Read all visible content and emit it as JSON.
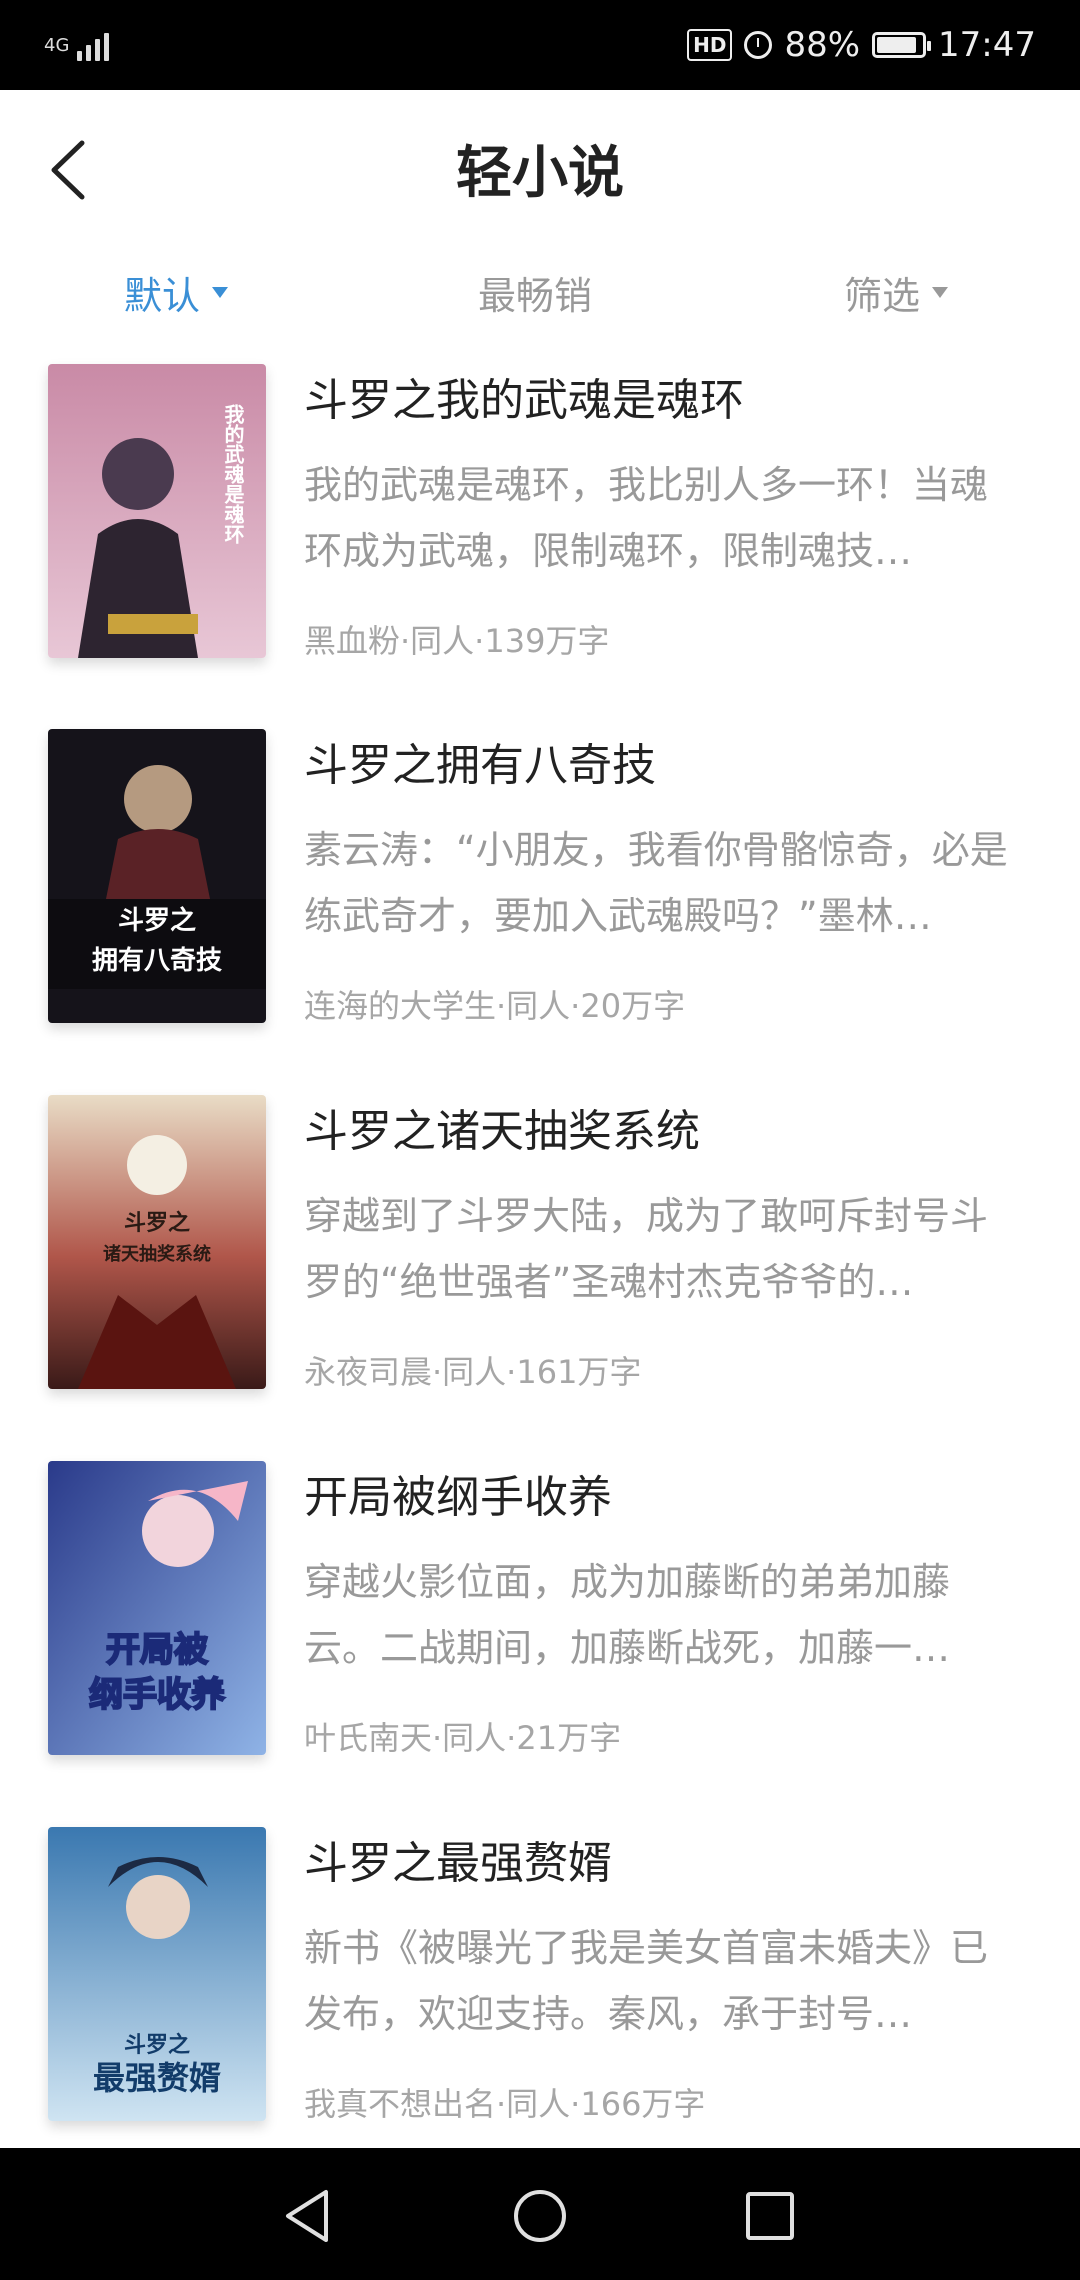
{
  "status_bar": {
    "network": "4G",
    "battery_percent": "88%",
    "battery_level": 0.88,
    "time": "17:47",
    "hd_badge": "HD"
  },
  "header": {
    "title": "轻小说"
  },
  "tabs": [
    {
      "label": "默认",
      "active": true,
      "has_dropdown": true
    },
    {
      "label": "最畅销",
      "active": false,
      "has_dropdown": false
    },
    {
      "label": "筛选",
      "active": false,
      "has_dropdown": true
    }
  ],
  "colors": {
    "accent": "#3a8fd6",
    "title_text": "#222222",
    "secondary_text": "#999999"
  },
  "books": [
    {
      "title": "斗罗之我的武魂是魂环",
      "description": "我的武魂是魂环，我比别人多一环！当魂环成为武魂，限制魂环，限制魂技…",
      "meta": "黑血粉·同人·139万字",
      "cover_text": "我的武魂是魂环"
    },
    {
      "title": "斗罗之拥有八奇技",
      "description": "素云涛：“小朋友，我看你骨骼惊奇，必是练武奇才，要加入武魂殿吗？”墨林…",
      "meta": "连海的大学生·同人·20万字",
      "cover_text": "斗罗之拥有八奇技"
    },
    {
      "title": "斗罗之诸天抽奖系统",
      "description": "穿越到了斗罗大陆，成为了敢呵斥封号斗罗的“绝世强者”圣魂村杰克爷爷的…",
      "meta": "永夜司晨·同人·161万字",
      "cover_text": "斗罗之诸天抽奖系统"
    },
    {
      "title": "开局被纲手收养",
      "description": "穿越火影位面，成为加藤断的弟弟加藤云。二战期间，加藤断战死，加藤一…",
      "meta": "叶氏南天·同人·21万字",
      "cover_text": "开局被纲手收养"
    },
    {
      "title": "斗罗之最强赘婿",
      "description": "新书《被曝光了我是美女首富未婚夫》已发布，欢迎支持。秦风，承于封号…",
      "meta": "我真不想出名·同人·166万字",
      "cover_text": "斗罗之最强赘婿"
    }
  ]
}
